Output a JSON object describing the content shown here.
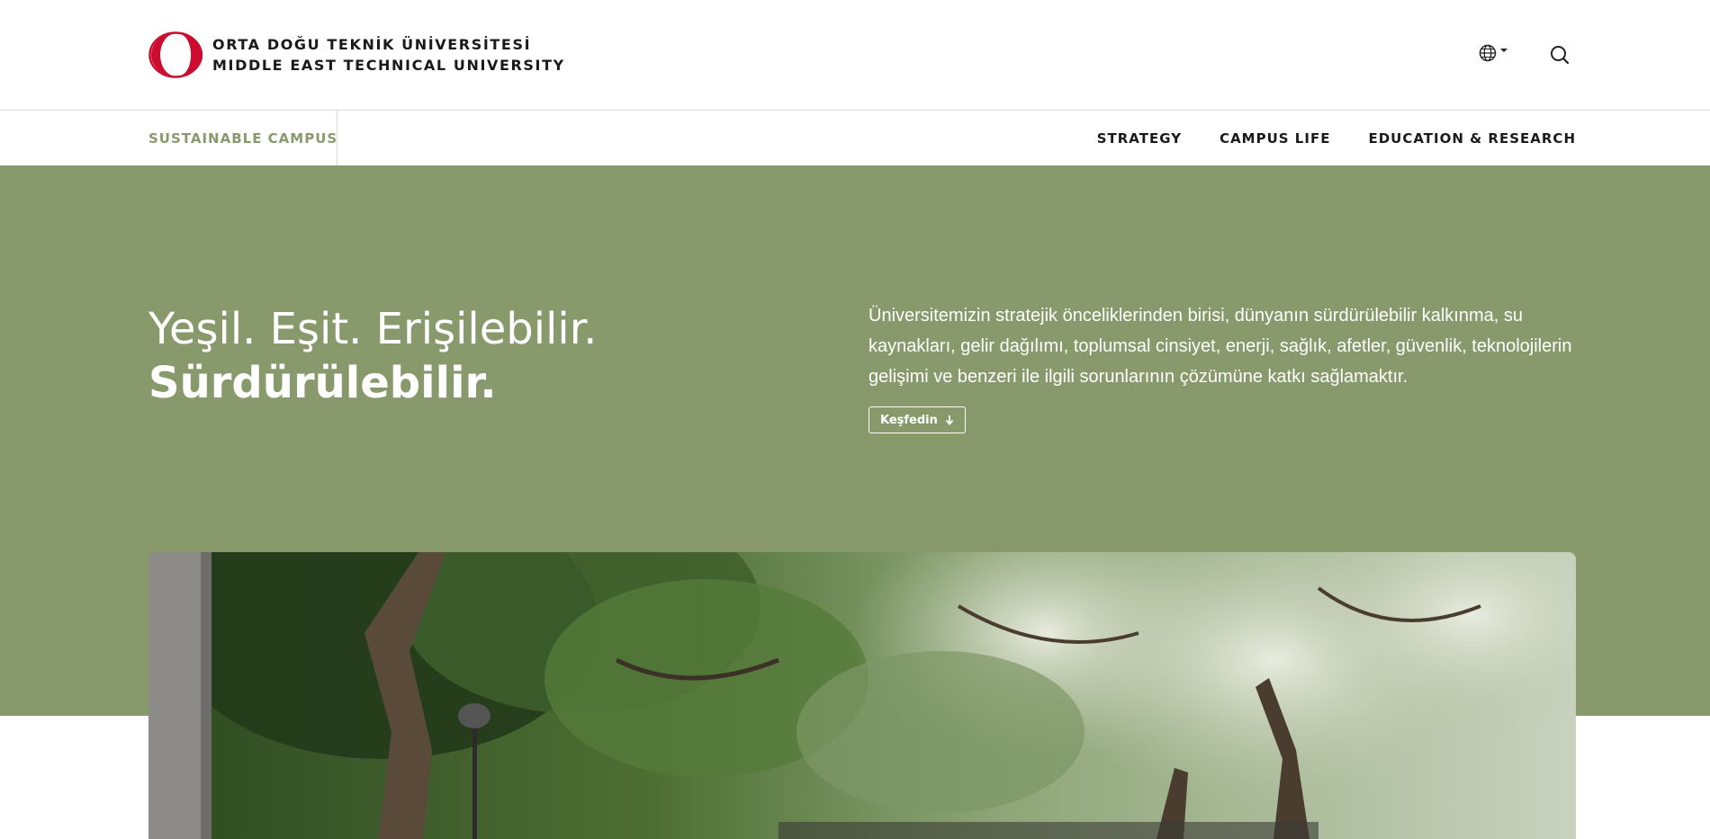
{
  "header": {
    "logo_line1": "ORTA DOĞU TEKNİK ÜNİVERSİTESİ",
    "logo_line2": "MIDDLE EAST TECHNICAL UNIVERSITY",
    "language_icon": "globe-icon",
    "search_icon": "search-icon"
  },
  "subnav": {
    "brand": "SUSTAINABLE CAMPUS",
    "links": [
      "STRATEGY",
      "CAMPUS LIFE",
      "EDUCATION & RESEARCH"
    ]
  },
  "hero": {
    "title_light": "Yeşil. Eşit. Erişilebilir.",
    "title_bold": "Sürdürülebilir.",
    "description": "Üniversitemizin stratejik önceliklerinden birisi, dünyanın sürdürülebilir kalkınma, su kaynakları, gelir dağılımı, toplumsal cinsiyet, enerji, sağlık, afetler, güvenlik, teknolojilerin gelişimi ve benzeri ile ilgili sorunlarının çözümüne katkı sağlamaktır.",
    "button_label": "Keşfedin"
  },
  "colors": {
    "brand_green": "#889a6c",
    "logo_red": "#cc0c2f"
  }
}
